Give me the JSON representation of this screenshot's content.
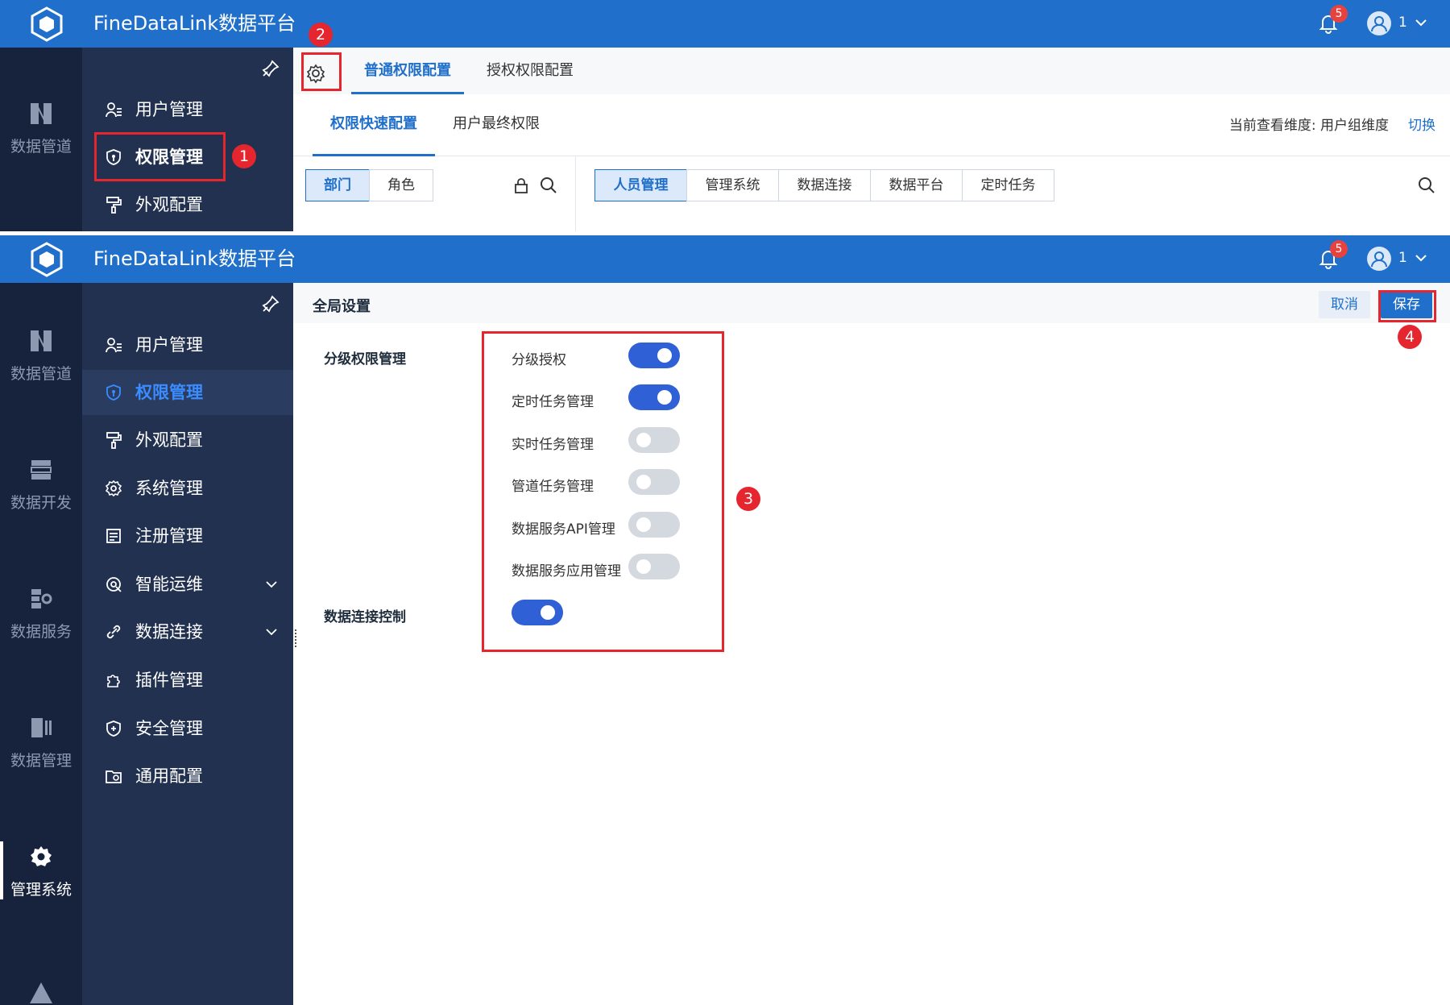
{
  "app": {
    "title": "FineDataLink数据平台",
    "notifications": "5",
    "user": "1"
  },
  "shot1": {
    "rail": {
      "items": [
        {
          "label": "数据管道",
          "icon": "pipeline-icon"
        }
      ]
    },
    "sidebar": {
      "items": [
        {
          "label": "用户管理",
          "icon": "user-list-icon"
        },
        {
          "label": "权限管理",
          "icon": "shield-key-icon"
        },
        {
          "label": "外观配置",
          "icon": "paint-roller-icon"
        }
      ]
    },
    "tabs": [
      {
        "label": "普通权限配置"
      },
      {
        "label": "授权权限配置"
      }
    ],
    "subtabs": [
      {
        "label": "权限快速配置"
      },
      {
        "label": "用户最终权限"
      }
    ],
    "dimension": {
      "label": "当前查看维度: 用户组维度",
      "switch": "切换"
    },
    "left_segments": [
      "部门",
      "角色"
    ],
    "right_segments": [
      "人员管理",
      "管理系统",
      "数据连接",
      "数据平台",
      "定时任务"
    ],
    "annotations": [
      "1",
      "2"
    ]
  },
  "shot2": {
    "rail": {
      "items": [
        {
          "label": "数据管道",
          "icon": "pipeline-icon"
        },
        {
          "label": "数据开发",
          "icon": "dev-icon"
        },
        {
          "label": "数据服务",
          "icon": "service-icon"
        },
        {
          "label": "数据管理",
          "icon": "data-manage-icon"
        },
        {
          "label": "管理系统",
          "icon": "gear-icon",
          "active": true
        }
      ]
    },
    "sidebar": {
      "items": [
        {
          "label": "用户管理",
          "icon": "user-list-icon"
        },
        {
          "label": "权限管理",
          "icon": "shield-key-icon",
          "active": true
        },
        {
          "label": "外观配置",
          "icon": "paint-roller-icon"
        },
        {
          "label": "系统管理",
          "icon": "gear-icon"
        },
        {
          "label": "注册管理",
          "icon": "register-icon"
        },
        {
          "label": "智能运维",
          "icon": "ops-icon",
          "expandable": true
        },
        {
          "label": "数据连接",
          "icon": "link-icon",
          "expandable": true
        },
        {
          "label": "插件管理",
          "icon": "plugin-icon"
        },
        {
          "label": "安全管理",
          "icon": "shield-plus-icon"
        },
        {
          "label": "通用配置",
          "icon": "folder-gear-icon"
        }
      ]
    },
    "global_settings": {
      "title": "全局设置",
      "cancel": "取消",
      "save": "保存",
      "groups": [
        {
          "label": "分级权限管理",
          "options": [
            {
              "label": "分级授权",
              "on": true
            },
            {
              "label": "定时任务管理",
              "on": true
            },
            {
              "label": "实时任务管理",
              "on": false
            },
            {
              "label": "管道任务管理",
              "on": false
            },
            {
              "label": "数据服务API管理",
              "on": false
            },
            {
              "label": "数据服务应用管理",
              "on": false
            }
          ]
        },
        {
          "label": "数据连接控制",
          "on": true
        }
      ]
    },
    "annotations": [
      "3",
      "4"
    ]
  },
  "colors": {
    "topbar": "#1f6fcb",
    "rail": "#17223d",
    "sidebar": "#22314f",
    "accent": "#1f6fcb",
    "toggle_on": "#2f60d5",
    "annotation": "#e5262e"
  }
}
